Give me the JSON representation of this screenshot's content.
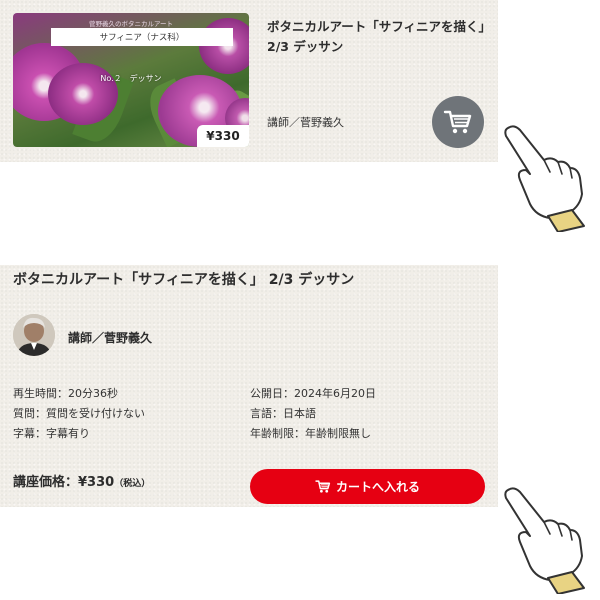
{
  "colors": {
    "panel_background": "#f1eee8",
    "cart_circle": "#6f7479",
    "add_to_cart": "#e60012",
    "hand_cuff": "#e8d383"
  },
  "course_card": {
    "thumbnail": {
      "series": "菅野義久のボタニカルアート",
      "label": "サフィニア（ナス科）",
      "episode": "No.２　デッサン",
      "price": "¥330"
    },
    "title": "ボタニカルアート「サフィニアを描く」2/3 デッサン",
    "instructor": "講師／菅野義久",
    "cart_icon": "cart-icon"
  },
  "course_detail": {
    "title": "ボタニカルアート「サフィニアを描く」 2/3 デッサン",
    "instructor": "講師／菅野義久",
    "left_meta": [
      "再生時間：20分36秒",
      "質問：質問を受け付けない",
      "字幕：字幕有り"
    ],
    "right_meta": [
      "公開日：2024年6月20日",
      "言語：日本語",
      "年齢制限：年齢制限無し"
    ],
    "price_label": "講座価格：¥330",
    "price_tax": "（税込）",
    "add_to_cart": "カートへ入れる",
    "add_to_cart_icon": "cart-icon"
  },
  "pointers": [
    "pointing-hand-icon",
    "pointing-hand-icon"
  ]
}
